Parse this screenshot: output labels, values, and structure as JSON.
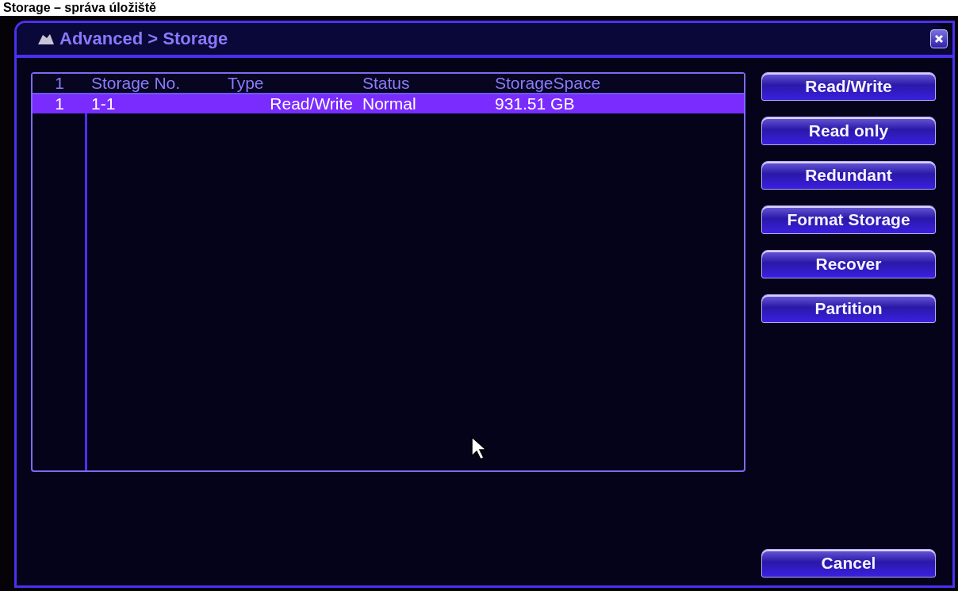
{
  "caption": "Storage – správa úložiště",
  "window": {
    "title": "Advanced > Storage"
  },
  "table": {
    "columns": [
      "1",
      "Storage No.",
      "Type",
      "Status",
      "StorageSpace"
    ],
    "rows": [
      {
        "selected": true,
        "cells": [
          "1",
          "1-1",
          "Read/Write",
          "Normal",
          "931.51 GB"
        ]
      }
    ]
  },
  "buttons": [
    "Read/Write",
    "Read only",
    "Redundant",
    "Format Storage",
    "Recover",
    "Partition"
  ],
  "cancel": "Cancel"
}
